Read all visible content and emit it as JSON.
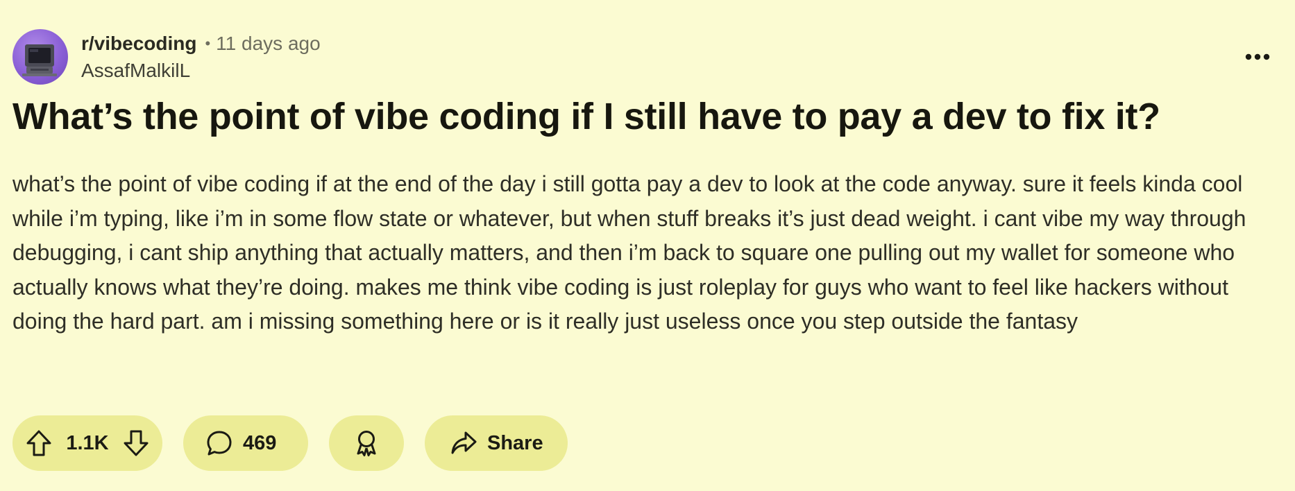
{
  "post": {
    "subreddit": "r/vibecoding",
    "separator": "•",
    "time_ago": "11 days ago",
    "author": "AssafMalkilL",
    "title": "What’s the point of vibe coding if I still have to pay a dev to fix it?",
    "body": "what’s the point of vibe coding if at the end of the day i still gotta pay a dev to look at the code anyway. sure it feels kinda cool while i’m typing, like i’m in some flow state or whatever, but when stuff breaks it’s just dead weight. i cant vibe my way through debugging, i cant ship anything that actually matters, and then i’m back to square one pulling out my wallet for someone who actually knows what they’re doing. makes me think vibe coding is just roleplay for guys who want to feel like hackers without doing the hard part. am i missing something here or is it really just useless once you step outside the fantasy"
  },
  "actions": {
    "vote_count": "1.1K",
    "comment_count": "469",
    "share_label": "Share"
  },
  "icons": {
    "avatar": "retro-computer-avatar",
    "more": "more-horizontal-icon",
    "upvote": "upvote-arrow-icon",
    "downvote": "downvote-arrow-icon",
    "comment": "comment-bubble-icon",
    "award": "award-ribbon-icon",
    "share": "share-arrow-icon"
  },
  "colors": {
    "background": "#fbfbd2",
    "pill": "#ecec96",
    "text": "#1b1b14",
    "muted": "#6d6d5e"
  }
}
